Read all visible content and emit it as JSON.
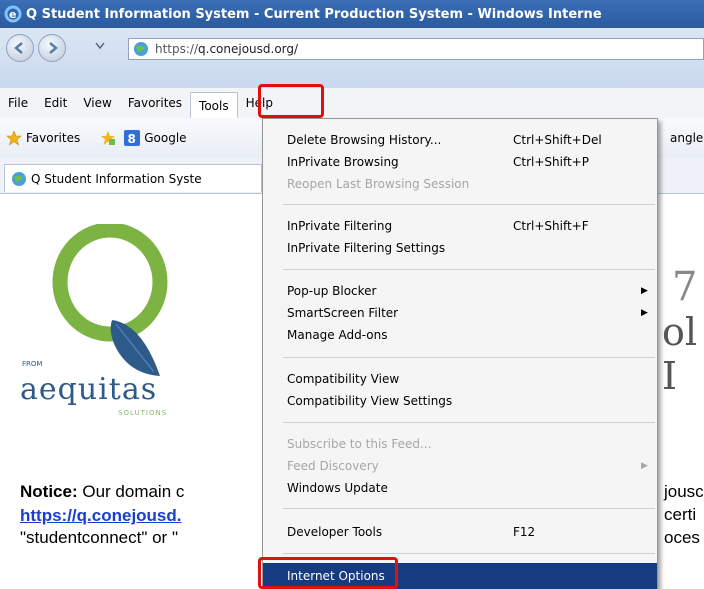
{
  "window": {
    "title": "Q Student Information System - Current Production System - Windows Interne"
  },
  "address": {
    "url_prefix": "https://",
    "url_domain": "q.conejousd.org/"
  },
  "menubar": {
    "items": [
      "File",
      "Edit",
      "View",
      "Favorites",
      "Tools",
      "Help"
    ]
  },
  "favorites_bar": {
    "favorites_label": "Favorites",
    "google_label": "Google",
    "right_fragment": "angle"
  },
  "tab": {
    "label": "Q Student Information Syste"
  },
  "tools_menu": {
    "items": [
      {
        "label": "Delete Browsing History...",
        "shortcut": "Ctrl+Shift+Del",
        "enabled": true
      },
      {
        "label": "InPrivate Browsing",
        "shortcut": "Ctrl+Shift+P",
        "enabled": true
      },
      {
        "label": "Reopen Last Browsing Session",
        "shortcut": "",
        "enabled": false
      },
      {
        "label": "InPrivate Filtering",
        "shortcut": "Ctrl+Shift+F",
        "enabled": true
      },
      {
        "label": "InPrivate Filtering Settings",
        "shortcut": "",
        "enabled": true
      },
      {
        "label": "Pop-up Blocker",
        "shortcut": "",
        "enabled": true,
        "submenu": true
      },
      {
        "label": "SmartScreen Filter",
        "shortcut": "",
        "enabled": true,
        "submenu": true
      },
      {
        "label": "Manage Add-ons",
        "shortcut": "",
        "enabled": true
      },
      {
        "label": "Compatibility View",
        "shortcut": "",
        "enabled": true
      },
      {
        "label": "Compatibility View Settings",
        "shortcut": "",
        "enabled": true
      },
      {
        "label": "Subscribe to this Feed...",
        "shortcut": "",
        "enabled": false
      },
      {
        "label": "Feed Discovery",
        "shortcut": "",
        "enabled": false,
        "submenu": true
      },
      {
        "label": "Windows Update",
        "shortcut": "",
        "enabled": true
      },
      {
        "label": "Developer Tools",
        "shortcut": "F12",
        "enabled": true
      },
      {
        "label": "Internet Options",
        "shortcut": "",
        "enabled": true,
        "highlighted": true
      }
    ]
  },
  "page": {
    "logo_from": "FROM",
    "logo_brand": "aequitas",
    "logo_solutions": "SOLUTIONS",
    "notice_bold": "Notice:",
    "notice_text": " Our domain c",
    "notice_link": "https://q.conejousd.",
    "notice_quote": "\"studentconnect\" or \"",
    "right_frag_1": "jousc",
    "right_frag_2": "certi",
    "right_frag_3": "oces",
    "bg_frag_1": "7",
    "bg_frag_2": "ol I"
  },
  "colors": {
    "highlight": "#163b80",
    "callout": "#e01010",
    "link": "#1a3fd0",
    "logo_green": "#7cb342",
    "logo_blue": "#2e5a8a"
  }
}
